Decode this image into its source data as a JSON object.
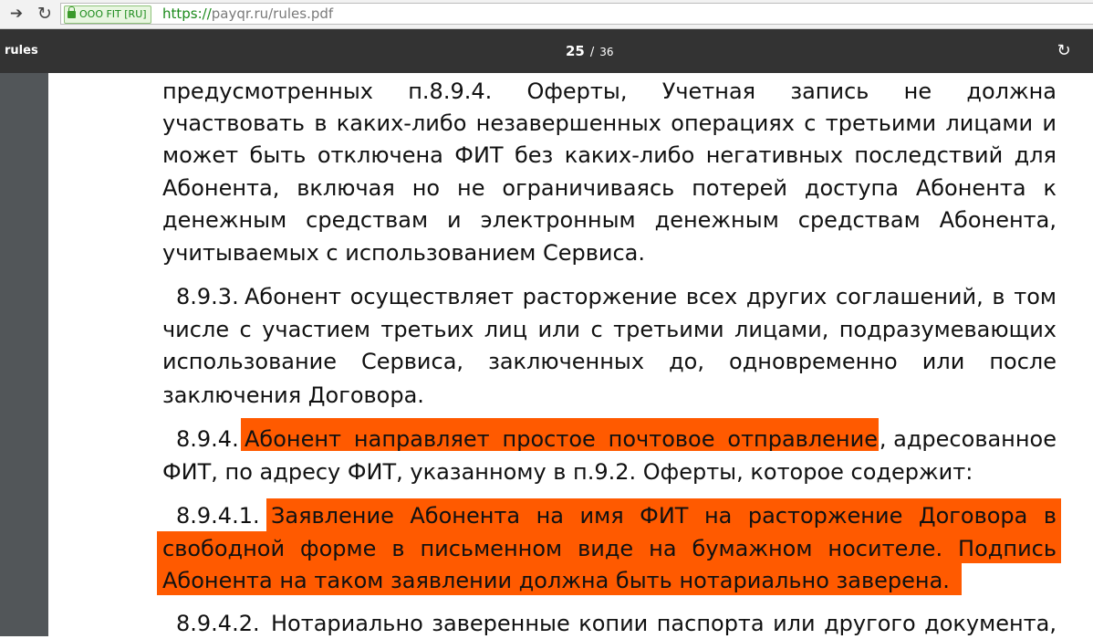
{
  "browser": {
    "back_icon": "back-arrow-icon",
    "reload_icon": "reload-icon",
    "ssl_label": "OOO FIT [RU]",
    "url_scheme": "https://",
    "url_rest": "payqr.ru/rules.pdf"
  },
  "pdf_toolbar": {
    "title": "rules",
    "current_page": "25",
    "separator": "/",
    "total_pages": "36",
    "rotate_icon": "rotate-icon"
  },
  "colors": {
    "highlight": "#ff5a00",
    "toolbar": "#333333",
    "viewer_bg": "#525659"
  },
  "page": {
    "para1": [
      "предусмотренных п.8.9.4. Оферты, Учетная запись не должна",
      "участвовать в каких-либо незавершенных операциях с третьими лицами и",
      "может быть отключена ФИТ без каких-либо негативных последствий для",
      "Абонента, включая но не ограничиваясь потерей доступа Абонента к",
      "денежным средствам и электронным денежным средствам Абонента,",
      "учитываемых с использованием Сервиса."
    ],
    "p893_num": "8.9.3.",
    "p893_lines": [
      "Абонент осуществляет расторжение всех других соглашений, в том",
      "числе с участием третьих лиц или с третьими лицами, подразумевающих",
      "использование Сервиса, заключенных до, одновременно или после",
      "заключения Договора."
    ],
    "p894_num": "8.9.4.",
    "p894_highlight": "Абонент направляет простое почтовое отправление",
    "p894_rest": ", адресованное",
    "p894_line2": "ФИТ, по адресу ФИТ, указанному в п.9.2. Оферты, которое содержит:",
    "p8941_num": "8.9.4.1.",
    "p8941_lines": [
      "Заявление Абонента на имя ФИТ на расторжение Договора в",
      "свободной форме в письменном виде на бумажном носителе. Подпись",
      "Абонента на таком заявлении должна быть нотариально заверена."
    ],
    "p8942_num": "8.9.4.2.",
    "p8942_text": "Нотариально заверенные копии паспорта или другого документа,"
  }
}
